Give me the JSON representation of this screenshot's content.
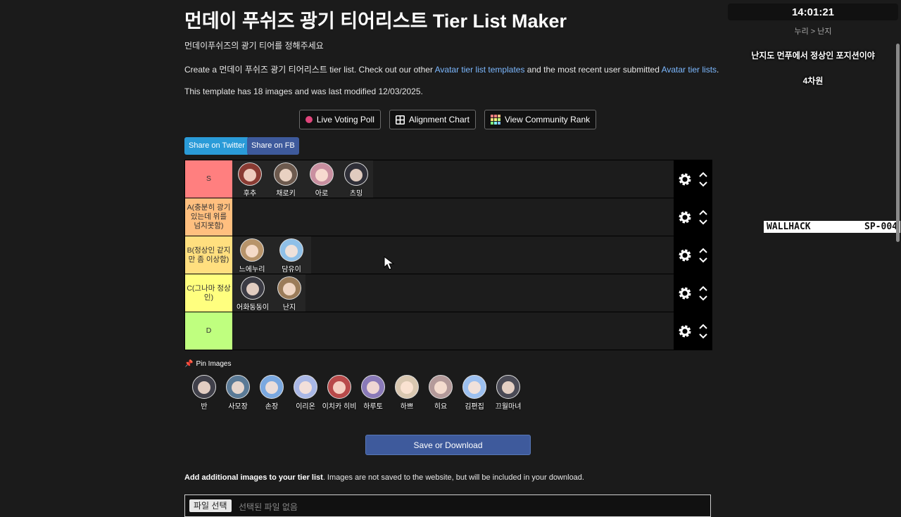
{
  "title": "먼데이 푸쉬즈 광기 티어리스트 Tier List Maker",
  "subtitle": "먼데이푸쉬즈의 광기 티어를 정해주세요",
  "intro": {
    "before": "Create a 먼데이 푸쉬즈 광기 티어리스트 tier list. Check out our other ",
    "link1": "Avatar tier list templates",
    "middle": " and the most recent user submitted ",
    "link2": "Avatar tier lists",
    "after": "."
  },
  "template_info": "This template has 18 images and was last modified 12/03/2025.",
  "buttons": {
    "live_voting": "Live Voting Poll",
    "alignment": "Alignment Chart",
    "community_rank": "View Community Rank",
    "share_twitter": "Share on Twitter",
    "share_fb": "Share on FB",
    "save": "Save or Download"
  },
  "tiers": [
    {
      "label": "S",
      "color": "#ff7f7f",
      "items": [
        "후추",
        "채로키",
        "아로",
        "츠밍"
      ]
    },
    {
      "label": "A(충분히 광기 있는데 위를 넘지못함)",
      "color": "#ffbf7f",
      "items": []
    },
    {
      "label": "B(정상인 같지만 좀 이상함)",
      "color": "#ffdf7f",
      "items": [
        "느에누리",
        "담유이"
      ]
    },
    {
      "label": "C(그나마 정상인)",
      "color": "#ffff7f",
      "items": [
        "어화동동이",
        "난지"
      ]
    },
    {
      "label": "D",
      "color": "#bfff7f",
      "items": []
    }
  ],
  "pin_label": "Pin Images",
  "pool": [
    "반",
    "사모장",
    "손장",
    "이리온",
    "이치카 히비",
    "하루토",
    "하쁘",
    "히요",
    "김편집",
    "끄월마녀"
  ],
  "add_images": {
    "bold": "Add additional images to your tier list",
    "rest": ". Images are not saved to the website, but will be included in your download."
  },
  "file_input": {
    "button": "파일 선택",
    "text": "선택된 파일 없음"
  },
  "overlay": {
    "clock": "14:01:21",
    "breadcrumb": "누리 > 난지",
    "line1": "난지도 먼푸에서 정상인 포지션이야",
    "line2": "4차원",
    "wallhack_left": "WALLHACK",
    "wallhack_right": "SP-004"
  }
}
